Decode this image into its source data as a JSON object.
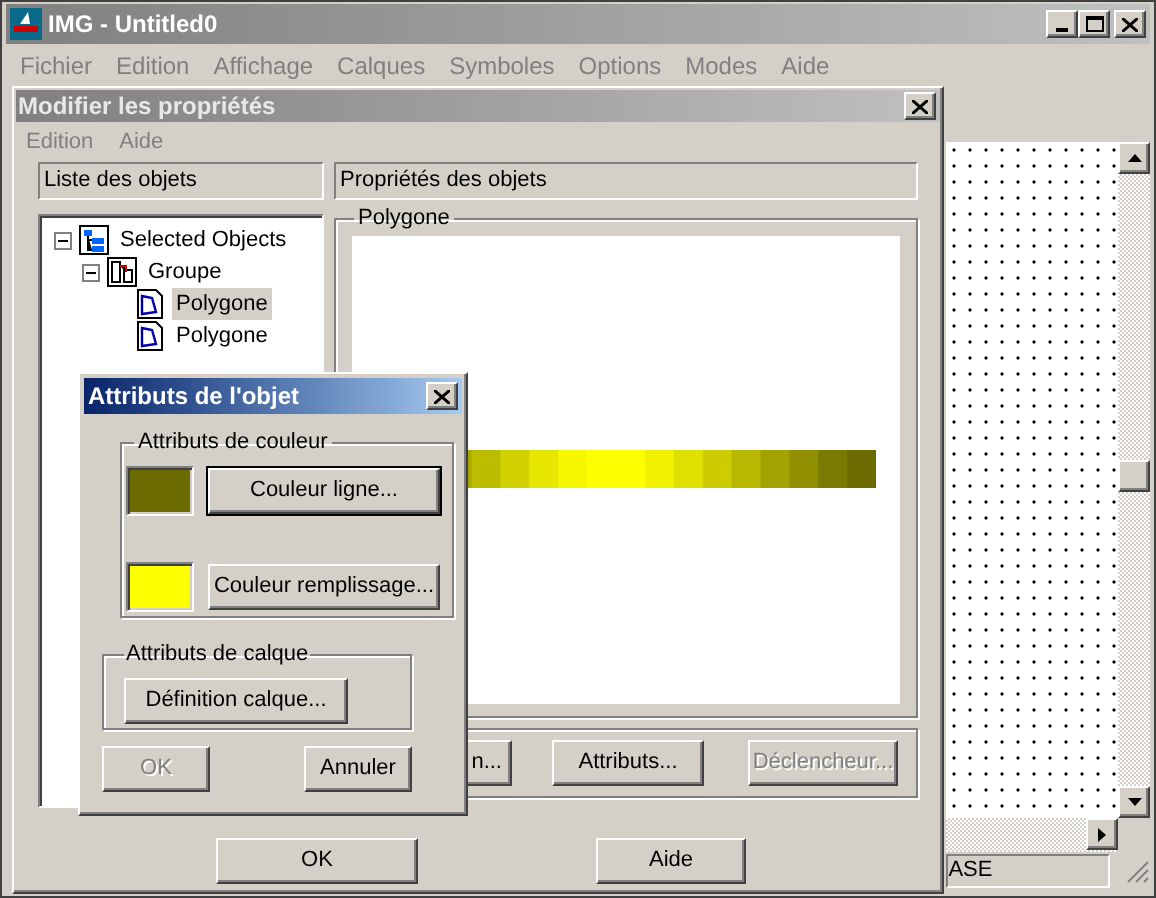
{
  "window": {
    "title": "IMG - Untitled0"
  },
  "menu": [
    "Fichier",
    "Edition",
    "Affichage",
    "Calques",
    "Symboles",
    "Options",
    "Modes",
    "Aide"
  ],
  "properties_panel": {
    "title": "Modifier les propriétés",
    "menu": [
      "Edition",
      "Aide"
    ],
    "list_header": "Liste des objets",
    "props_header": "Propriétés des objets",
    "tree": [
      {
        "label": "Selected Objects",
        "kind": "selection",
        "expanded": true,
        "selected": false,
        "children": [
          {
            "label": "Groupe",
            "kind": "group",
            "expanded": true,
            "selected": false,
            "children": [
              {
                "label": "Polygone",
                "kind": "polygon",
                "selected": true
              },
              {
                "label": "Polygone",
                "kind": "polygon",
                "selected": false
              }
            ]
          }
        ]
      }
    ],
    "preview_title": "Polygone",
    "action_buttons": [
      {
        "label": "n...",
        "disabled": false
      },
      {
        "label": "Attributs...",
        "disabled": false
      },
      {
        "label": "Déclencheur...",
        "disabled": true
      }
    ],
    "footer_buttons": [
      {
        "label": "OK"
      },
      {
        "label": "Aide"
      }
    ]
  },
  "status_bar": {
    "text": "ASE"
  },
  "dialog": {
    "title": "Attributs de l'objet",
    "color_group": {
      "title": "Attributs de couleur",
      "rows": [
        {
          "color": "#6b6b00",
          "button": "Couleur ligne...",
          "default": true
        },
        {
          "color": "#ffff00",
          "button": "Couleur remplissage...",
          "default": false
        }
      ]
    },
    "layer_group": {
      "title": "Attributs de calque",
      "button": "Définition calque..."
    },
    "buttons": [
      {
        "label": "OK",
        "disabled": true
      },
      {
        "label": "Annuler",
        "disabled": false
      }
    ]
  }
}
